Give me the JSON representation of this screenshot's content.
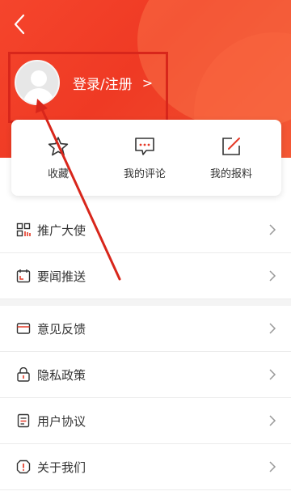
{
  "header": {
    "login_label": "登录/注册",
    "login_arrow": ">"
  },
  "quick_actions": [
    {
      "label": "收藏",
      "icon": "star-icon"
    },
    {
      "label": "我的评论",
      "icon": "comment-icon"
    },
    {
      "label": "我的报料",
      "icon": "edit-report-icon"
    }
  ],
  "menu_group1": [
    {
      "label": "推广大使",
      "icon": "grid-icon"
    },
    {
      "label": "要闻推送",
      "icon": "calendar-icon"
    }
  ],
  "menu_group2": [
    {
      "label": "意见反馈",
      "icon": "feedback-icon"
    },
    {
      "label": "隐私政策",
      "icon": "lock-icon"
    },
    {
      "label": "用户协议",
      "icon": "document-icon"
    },
    {
      "label": "关于我们",
      "icon": "info-icon"
    }
  ],
  "colors": {
    "brand": "#f5452c",
    "annotation": "#d8261b"
  }
}
